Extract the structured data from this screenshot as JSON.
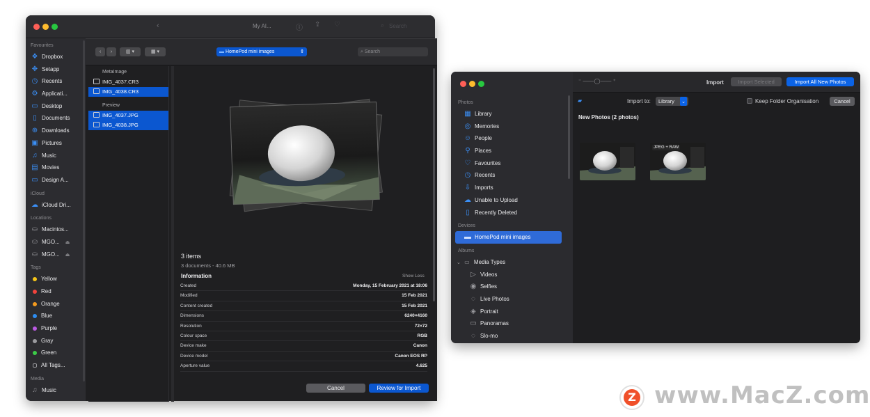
{
  "colors": {
    "accent": "#2f6bd8",
    "selection": "#0b57d0",
    "window": "#232326"
  },
  "finder": {
    "window_title": "My AI...",
    "search_placeholder": "Search",
    "favourites_label": "Favourites",
    "favourites": [
      {
        "label": "Dropbox",
        "icon": "dropbox-icon"
      },
      {
        "label": "Setapp",
        "icon": "setapp-icon"
      },
      {
        "label": "Recents",
        "icon": "clock-icon"
      },
      {
        "label": "Applicati...",
        "icon": "applications-icon"
      },
      {
        "label": "Desktop",
        "icon": "desktop-icon"
      },
      {
        "label": "Documents",
        "icon": "document-icon"
      },
      {
        "label": "Downloads",
        "icon": "download-icon"
      },
      {
        "label": "Pictures",
        "icon": "pictures-icon"
      },
      {
        "label": "Music",
        "icon": "music-icon"
      },
      {
        "label": "Movies",
        "icon": "film-icon"
      },
      {
        "label": "Design A...",
        "icon": "folder-icon"
      }
    ],
    "icloud_label": "iCloud",
    "icloud": [
      {
        "label": "iCloud Dri...",
        "icon": "cloud-icon"
      }
    ],
    "locations_label": "Locations",
    "locations": [
      {
        "label": "Macintos...",
        "icon": "disk-icon"
      },
      {
        "label": "MGO...",
        "icon": "disk-icon"
      },
      {
        "label": "MGO...",
        "icon": "disk-icon"
      }
    ],
    "tags_label": "Tags",
    "tags": [
      {
        "label": "Yellow",
        "color": "#f5c518"
      },
      {
        "label": "Red",
        "color": "#f2433c"
      },
      {
        "label": "Orange",
        "color": "#f39a1f"
      },
      {
        "label": "Blue",
        "color": "#2d8cf0"
      },
      {
        "label": "Purple",
        "color": "#bb5ae3"
      },
      {
        "label": "Gray",
        "color": "#9a9a9e"
      },
      {
        "label": "Green",
        "color": "#3ccc48"
      },
      {
        "label": "All Tags...",
        "color": ""
      }
    ],
    "media_label": "Media",
    "media": [
      {
        "label": "Music",
        "icon": "music-icon"
      }
    ]
  },
  "dialog": {
    "location": "HomePod mini images",
    "search_placeholder": "Search",
    "groups": [
      {
        "header": "MetaImage",
        "files": [
          {
            "name": "IMG_4037.CR3",
            "selected": false
          },
          {
            "name": "IMG_4038.CR3",
            "selected": true
          }
        ]
      },
      {
        "header": "Preview",
        "files": [
          {
            "name": "IMG_4037.JPG",
            "selected": true
          },
          {
            "name": "IMG_4038.JPG",
            "selected": true
          }
        ]
      }
    ],
    "summary_title": "3 items",
    "summary_sub": "3 documents - 40.6 MB",
    "information_label": "Information",
    "show_less": "Show Less",
    "info": [
      {
        "key": "Created",
        "value": "Monday, 15 February 2021 at 18:06"
      },
      {
        "key": "Modified",
        "value": "15 Feb 2021"
      },
      {
        "key": "Content created",
        "value": "15 Feb 2021"
      },
      {
        "key": "Dimensions",
        "value": "6240×4160"
      },
      {
        "key": "Resolution",
        "value": "72×72"
      },
      {
        "key": "Colour space",
        "value": "RGB"
      },
      {
        "key": "Device make",
        "value": "Canon"
      },
      {
        "key": "Device model",
        "value": "Canon EOS RP"
      },
      {
        "key": "Aperture value",
        "value": "4.625"
      }
    ],
    "cancel": "Cancel",
    "review": "Review for Import"
  },
  "photos": {
    "photos_label": "Photos",
    "photos_items": [
      {
        "label": "Library",
        "icon": "library-icon"
      },
      {
        "label": "Memories",
        "icon": "memories-icon"
      },
      {
        "label": "People",
        "icon": "people-icon"
      },
      {
        "label": "Places",
        "icon": "pin-icon"
      },
      {
        "label": "Favourites",
        "icon": "heart-icon"
      },
      {
        "label": "Recents",
        "icon": "clock-icon"
      },
      {
        "label": "Imports",
        "icon": "imports-icon"
      },
      {
        "label": "Unable to Upload",
        "icon": "cloud-icon"
      },
      {
        "label": "Recently Deleted",
        "icon": "trash-icon"
      }
    ],
    "devices_label": "Devices",
    "devices": [
      {
        "label": "HomePod mini images",
        "selected": true
      }
    ],
    "albums_label": "Albums",
    "media_types": "Media Types",
    "albums": [
      {
        "label": "Videos",
        "icon": "video-icon"
      },
      {
        "label": "Selfies",
        "icon": "selfie-icon"
      },
      {
        "label": "Live Photos",
        "icon": "live-icon"
      },
      {
        "label": "Portrait",
        "icon": "portrait-icon"
      },
      {
        "label": "Panoramas",
        "icon": "panorama-icon"
      },
      {
        "label": "Slo-mo",
        "icon": "slomo-icon"
      }
    ],
    "title": "Import",
    "import_selected": "Import Selected",
    "import_all": "Import All New Photos",
    "import_to_label": "Import to:",
    "import_to_value": "Library",
    "keep_folder": "Keep Folder Organisation",
    "cancel": "Cancel",
    "new_photos": "New Photos (2 photos)",
    "badge": "JPEG + RAW"
  },
  "watermark": "www.MacZ.com",
  "watermark_logo": "Z"
}
